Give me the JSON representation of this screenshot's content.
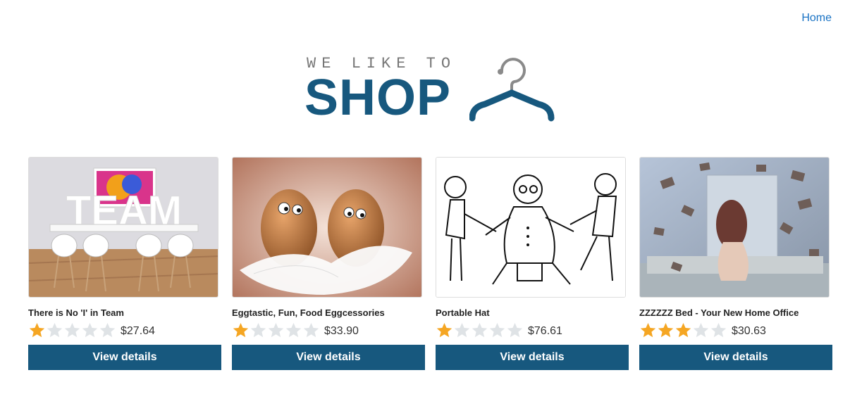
{
  "nav": {
    "home_label": "Home"
  },
  "logo": {
    "tagline": "WE LIKE TO",
    "word": "SHOP"
  },
  "colors": {
    "brand": "#17587e",
    "star_filled": "#f5a623",
    "star_empty": "#dfe3e6",
    "link": "#1a73c4"
  },
  "products": [
    {
      "title": "There is No 'I' in Team",
      "rating": 1,
      "max_rating": 5,
      "price": "$27.64",
      "button": "View details",
      "image": "team-table-photo"
    },
    {
      "title": "Eggtastic, Fun, Food Eggcessories",
      "rating": 1,
      "max_rating": 5,
      "price": "$33.90",
      "button": "View details",
      "image": "eggs-with-googly-eyes-photo"
    },
    {
      "title": "Portable Hat",
      "rating": 1,
      "max_rating": 5,
      "price": "$76.61",
      "button": "View details",
      "image": "cartoon-people-sketch"
    },
    {
      "title": "ZZZZZZ Bed - Your New Home Office",
      "rating": 3,
      "max_rating": 5,
      "price": "$30.63",
      "button": "View details",
      "image": "flying-books-bedroom-photo"
    }
  ]
}
